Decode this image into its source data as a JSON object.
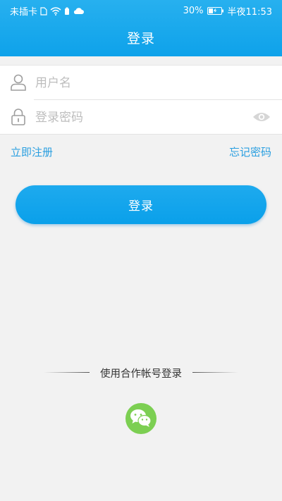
{
  "status_bar": {
    "carrier": "未插卡",
    "battery_percent": "30%",
    "time": "半夜11:53"
  },
  "header": {
    "title": "登录"
  },
  "form": {
    "username_placeholder": "用户名",
    "password_placeholder": "登录密码"
  },
  "links": {
    "register": "立即注册",
    "forgot_password": "忘记密码"
  },
  "login_button": {
    "label": "登录"
  },
  "third_party": {
    "label": "使用合作帐号登录",
    "providers": [
      "wechat"
    ]
  },
  "colors": {
    "primary": "#1aa7ee",
    "wechat": "#7ccf52",
    "link": "#2a9fe0"
  }
}
